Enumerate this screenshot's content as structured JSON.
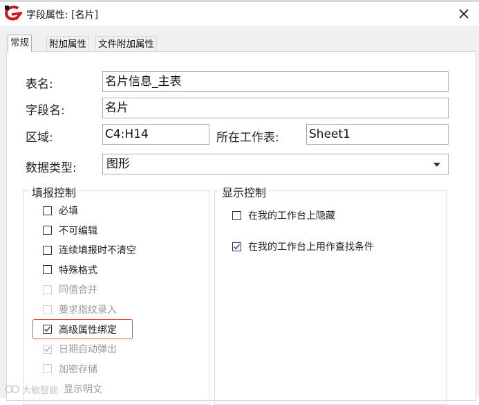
{
  "window": {
    "title": "字段属性: [名片]",
    "close_icon": "close-icon"
  },
  "tabs": [
    {
      "label": "常规",
      "active": true
    },
    {
      "label": "附加属性",
      "active": false
    },
    {
      "label": "文件附加属性",
      "active": false
    }
  ],
  "form": {
    "table_name_label": "表名:",
    "table_name_value": "名片信息_主表",
    "field_name_label": "字段名:",
    "field_name_value": "名片",
    "region_label": "区域:",
    "region_value": "C4:H14",
    "sheet_label": "所在工作表:",
    "sheet_value": "Sheet1",
    "data_type_label": "数据类型:",
    "data_type_value": "图形"
  },
  "fill_control": {
    "title": "填报控制",
    "items": [
      {
        "label": "必填",
        "checked": false,
        "disabled": false
      },
      {
        "label": "不可编辑",
        "checked": false,
        "disabled": false
      },
      {
        "label": "连续填报时不清空",
        "checked": false,
        "disabled": false
      },
      {
        "label": "特殊格式",
        "checked": false,
        "disabled": false
      },
      {
        "label": "同值合并",
        "checked": false,
        "disabled": true
      },
      {
        "label": "要求指纹录入",
        "checked": false,
        "disabled": true
      },
      {
        "label": "高级属性绑定",
        "checked": true,
        "disabled": false
      },
      {
        "label": "日期自动弹出",
        "checked": true,
        "disabled": true
      },
      {
        "label": "加密存储",
        "checked": false,
        "disabled": true
      }
    ],
    "partial_item_label": "显示明文"
  },
  "display_control": {
    "title": "显示控制",
    "items": [
      {
        "label": "在我的工作台上隐藏",
        "checked": false
      },
      {
        "label": "在我的工作台上用作查找条件",
        "checked": true
      }
    ]
  },
  "watermark": {
    "text": "大敏智能"
  },
  "colors": {
    "highlight": "#e05050",
    "check": "#1a5fb4",
    "check_disabled": "#9ab0cc"
  }
}
